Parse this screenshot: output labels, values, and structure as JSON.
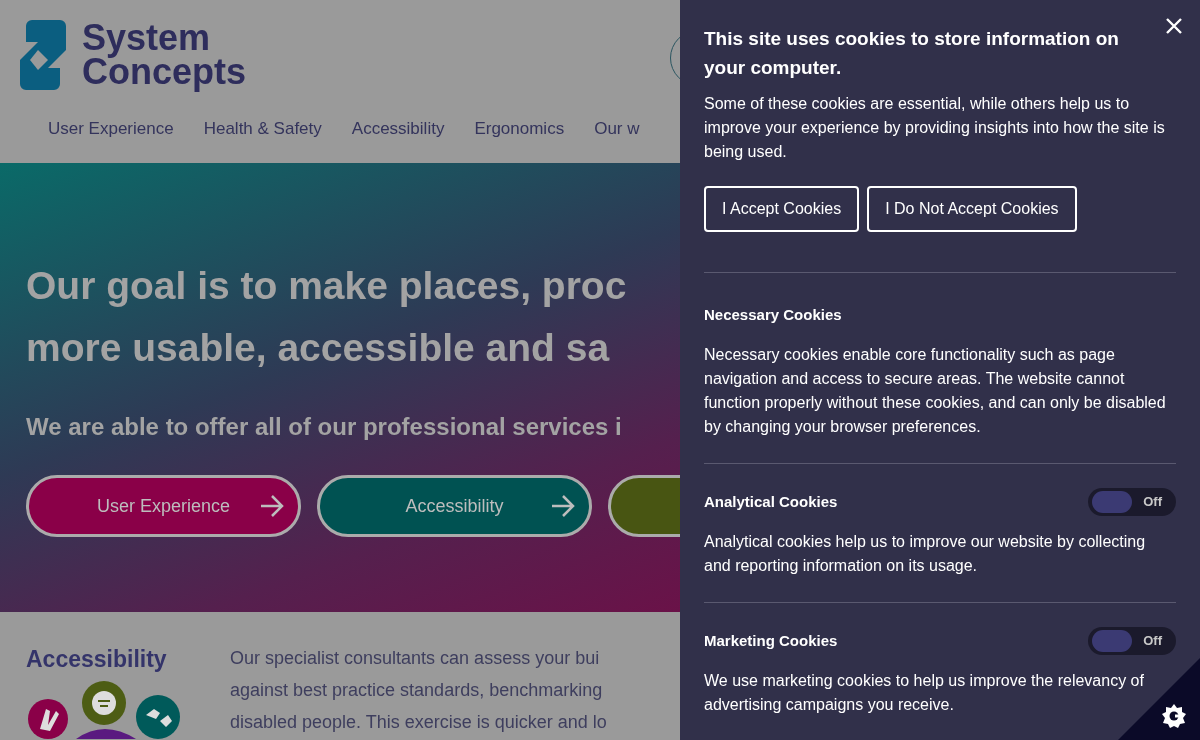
{
  "logo": {
    "lines": [
      "System",
      "Concepts"
    ]
  },
  "nav": [
    "User Experience",
    "Health & Safety",
    "Accessibility",
    "Ergonomics",
    "Our w"
  ],
  "hero": {
    "heading_lines": [
      "Our goal is to make places, proc",
      "more usable, accessible and sa"
    ],
    "subheading": "We are able to offer all of our professional services i",
    "buttons": [
      {
        "label": "User Experience",
        "color": "#8a0048"
      },
      {
        "label": "Accessibility",
        "color": "#005252"
      },
      {
        "color": "#485512"
      }
    ]
  },
  "section": {
    "title": "Accessibility",
    "text_lines": [
      "Our specialist consultants can assess your bui",
      "against best practice standards, benchmarking",
      "disabled people. This exercise is quicker and lo"
    ]
  },
  "cookie_panel": {
    "title": "This site uses cookies to store information on your computer.",
    "intro": "Some of these cookies are essential, while others help us to improve your experience by providing insights into how the site is being used.",
    "buttons": [
      "I Accept Cookies",
      "I Do Not Accept Cookies"
    ],
    "categories": [
      {
        "title": "Necessary Cookies",
        "text": "Necessary cookies enable core functionality such as page navigation and access to secure areas. The website cannot function properly without these cookies, and can only be disabled by changing your browser preferences."
      },
      {
        "title": "Analytical Cookies",
        "toggle": {
          "on": false,
          "label": "Off"
        },
        "text": "Analytical cookies help us to improve our website by collecting and reporting information on its usage."
      },
      {
        "title": "Marketing Cookies",
        "toggle": {
          "on": false,
          "label": "Off"
        },
        "text": "We use marketing cookies to help us improve the relevancy of advertising campaigns you receive."
      }
    ]
  }
}
